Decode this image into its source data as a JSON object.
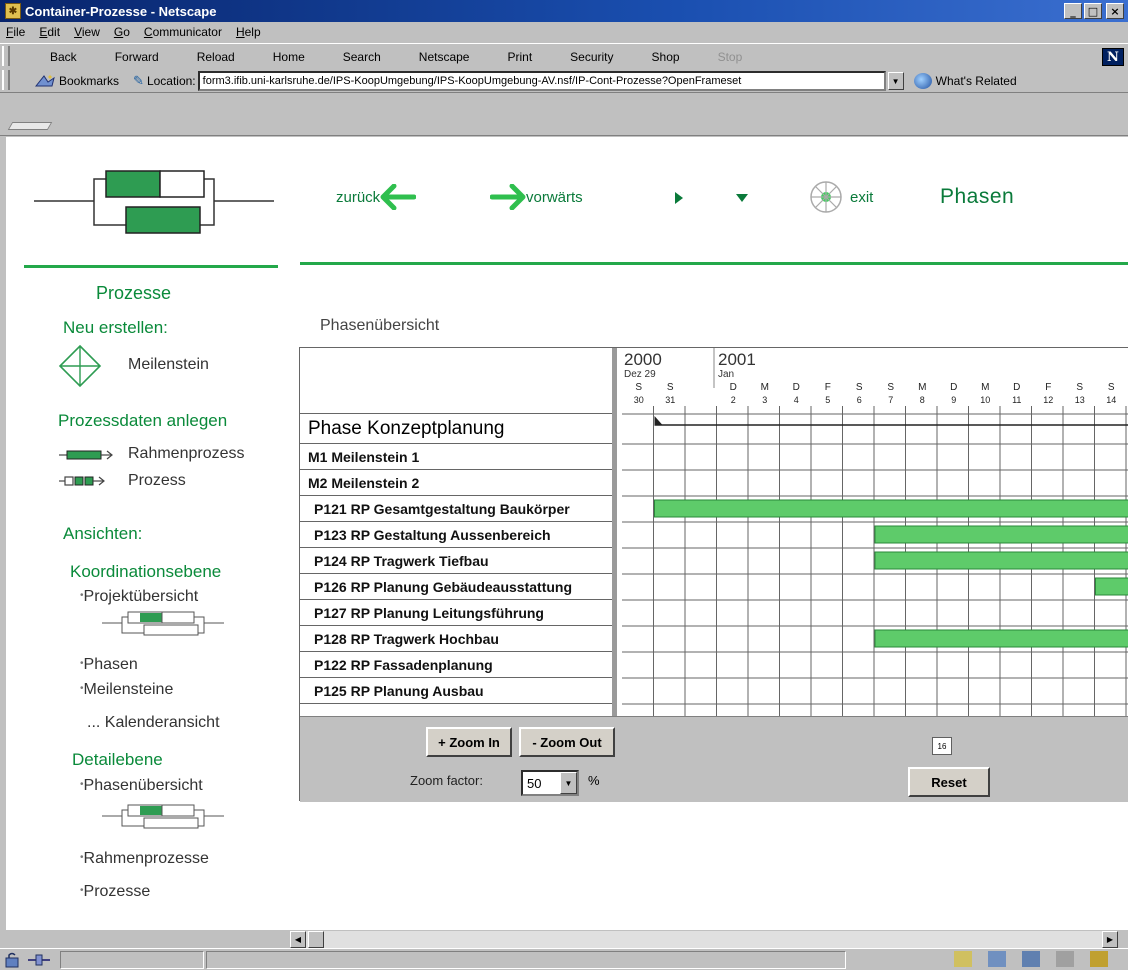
{
  "window": {
    "title": "Container-Prozesse - Netscape"
  },
  "menu": [
    "File",
    "Edit",
    "View",
    "Go",
    "Communicator",
    "Help"
  ],
  "toolbar": [
    "Back",
    "Forward",
    "Reload",
    "Home",
    "Search",
    "Netscape",
    "Print",
    "Security",
    "Shop",
    "Stop"
  ],
  "location": {
    "bookmarks_label": "Bookmarks",
    "location_label": "Location:",
    "url": "form3.ifib.uni-karlsruhe.de/IPS-KoopUmgebung/IPS-KoopUmgebung-AV.nsf/IP-Cont-Prozesse?OpenFrameset",
    "related_label": "What's Related"
  },
  "pagenav": {
    "back_label": "zurück",
    "forward_label": "vorwärts",
    "exit_label": "exit",
    "page_title": "Phasen"
  },
  "sidebar": {
    "section_title": "Prozesse",
    "new_title": "Neu erstellen:",
    "milestone_label": "Meilenstein",
    "procdata_title": "Prozessdaten anlegen",
    "frame_label": "Rahmenprozess",
    "process_label": "Prozess",
    "views_title": "Ansichten:",
    "coord_title": "Koordinationsebene",
    "project_overview": "Projektübersicht",
    "phases": "Phasen",
    "milestones": "Meilensteine",
    "calendar": "... Kalenderansicht",
    "detail_title": "Detailebene",
    "phase_overview": "Phasenübersicht",
    "frame_processes": "Rahmenprozesse",
    "processes": "Prozesse"
  },
  "main": {
    "subtitle": "Phasenübersicht",
    "rows": [
      "Phase Konzeptplanung",
      "M1 Meilenstein 1",
      "M2 Meilenstein 2",
      "P121 RP Gesamtgestaltung Baukörper",
      "P123 RP Gestaltung Aussenbereich",
      "P124 RP Tragwerk Tiefbau",
      "P126 RP Planung Gebäudeausstattung",
      "P127 RP Planung Leitungsführung",
      "P128 RP Tragwerk Hochbau",
      "P122 RP Fassadenplanung",
      "P125 RP Planung Ausbau"
    ],
    "timeline": {
      "year1": "2000",
      "year2": "2001",
      "month1": "Dez 29",
      "month2": "Jan",
      "days": [
        {
          "w": "S",
          "d": "30"
        },
        {
          "w": "S",
          "d": "31"
        },
        {
          "w": "",
          "d": ""
        },
        {
          "w": "D",
          "d": "2"
        },
        {
          "w": "M",
          "d": "3"
        },
        {
          "w": "D",
          "d": "4"
        },
        {
          "w": "F",
          "d": "5"
        },
        {
          "w": "S",
          "d": "6"
        },
        {
          "w": "S",
          "d": "7"
        },
        {
          "w": "M",
          "d": "8"
        },
        {
          "w": "D",
          "d": "9"
        },
        {
          "w": "M",
          "d": "10"
        },
        {
          "w": "D",
          "d": "11"
        },
        {
          "w": "F",
          "d": "12"
        },
        {
          "w": "S",
          "d": "13"
        },
        {
          "w": "S",
          "d": "14"
        }
      ],
      "bar_color": "#5ecb6a",
      "bars": [
        {
          "row": 3,
          "start": 1
        },
        {
          "row": 4,
          "start": 8
        },
        {
          "row": 5,
          "start": 8
        },
        {
          "row": 6,
          "start": 15
        },
        {
          "row": 8,
          "start": 8
        }
      ]
    },
    "zoom_in_label": "+ Zoom In",
    "zoom_out_label": "- Zoom Out",
    "zoom_factor_label": "Zoom factor:",
    "zoom_value": "50",
    "zoom_unit": "%",
    "calendar_icon_text": "16",
    "reset_label": "Reset"
  },
  "colors": {
    "accent_green": "#23a84a",
    "text_green": "#0a7a3a"
  }
}
